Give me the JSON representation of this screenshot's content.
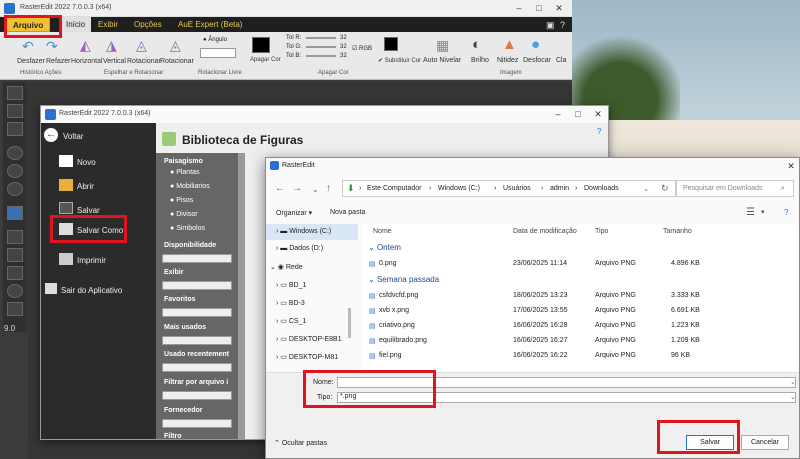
{
  "app": {
    "title": "RasterEdit 2022 7.0.0.3 (x64)",
    "menu": [
      "Arquivo",
      "Início",
      "Exibir",
      "Opções",
      "AuE Expert (Beta)"
    ],
    "ribbon": {
      "buttons": [
        "Desfazer",
        "Refazer",
        "Horizontal",
        "Vertical",
        "Rotacionar",
        "Rotacionar",
        "Apagar Cor",
        "Substituir Cor",
        "Auto Nivelar",
        "Brilho",
        "Nitidez",
        "Desfocar",
        "Cla"
      ],
      "groups": [
        "Histórico Ações",
        "Espelhar e Rotacionar",
        "Rotacionar Livre",
        "Apagar Cor",
        "Imagem"
      ],
      "angle_label": "Ângulo",
      "tol_labels": [
        "Tol R:",
        "Tol G:",
        "Tol B:"
      ],
      "tol_values": [
        "32",
        "32",
        "32"
      ],
      "rgb_label": "RGB"
    },
    "status_value": "9.0"
  },
  "library": {
    "title": "RasterEdit 2022 7.0.0.3 (x64)",
    "back": "Voltar",
    "items": [
      "Novo",
      "Abrir",
      "Salvar",
      "Salvar Como",
      "Imprimir",
      "Sair do Aplicativo"
    ],
    "heading": "Biblioteca de Figuras",
    "filters": {
      "paisagismo": "Paisagismo",
      "options": [
        "Plantas",
        "Mobiliarios",
        "Pisos",
        "Divisor",
        "Simbolos"
      ],
      "labels": [
        "Disponibilidade",
        "Exibir",
        "Favoritos",
        "Mais usados",
        "Usado recentement",
        "Filtrar por arquivo i",
        "Fornecedor",
        "Filtro"
      ]
    }
  },
  "dialog": {
    "title": "RasterEdit",
    "breadcrumb": [
      "Este Computador",
      "Windows (C:)",
      "Usuários",
      "admin",
      "Downloads"
    ],
    "search_placeholder": "Pesquisar em Downloads",
    "organize": "Organizar ▾",
    "new_folder": "Nova pasta",
    "tree": [
      "Windows (C:)",
      "Dados (D:)",
      "Rede",
      "BD_1",
      "BD-3",
      "CS_1",
      "DESKTOP-E8B1",
      "DESKTOP-M81"
    ],
    "columns": [
      "Nome",
      "Data de modificação",
      "Tipo",
      "Tamanho"
    ],
    "groups": [
      "Ontem",
      "Semana passada"
    ],
    "files": [
      {
        "name": "0.png",
        "date": "23/06/2025 11:14",
        "type": "Arquivo PNG",
        "size": "4.896 KB"
      },
      {
        "name": "csfdvcfd.png",
        "date": "18/06/2025 13:23",
        "type": "Arquivo PNG",
        "size": "3.333 KB"
      },
      {
        "name": "xvb x.png",
        "date": "17/06/2025 13:55",
        "type": "Arquivo PNG",
        "size": "6.691 KB"
      },
      {
        "name": "criativo.png",
        "date": "16/06/2025 16:28",
        "type": "Arquivo PNG",
        "size": "1.223 KB"
      },
      {
        "name": "equilibrado.png",
        "date": "16/06/2025 16:27",
        "type": "Arquivo PNG",
        "size": "1.209 KB"
      },
      {
        "name": "fiel.png",
        "date": "16/06/2025 16:22",
        "type": "Arquivo PNG",
        "size": "96 KB"
      }
    ],
    "name_label": "Nome:",
    "name_value": "",
    "type_label": "Tipo:",
    "type_value": "*.png",
    "hide_folders": "Ocultar pastas",
    "save": "Salvar",
    "cancel": "Cancelar"
  },
  "colors": {
    "accent": "#f2c232",
    "highlight": "#e0141e"
  }
}
